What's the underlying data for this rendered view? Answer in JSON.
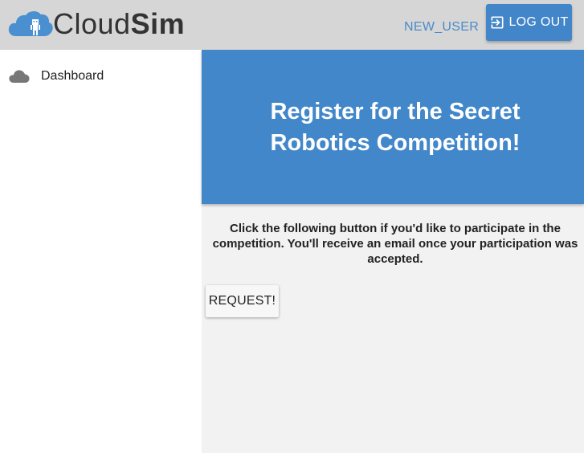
{
  "header": {
    "logo_text_regular": "Cloud",
    "logo_text_bold": "Sim",
    "username": "NEW_USER",
    "logout_label": "LOG OUT",
    "logout_icon": "exit-to-app-icon",
    "background": "#d6d6d6",
    "accent": "#4285c9"
  },
  "sidebar": {
    "items": [
      {
        "label": "Dashboard",
        "icon": "cloud-icon"
      }
    ]
  },
  "main": {
    "banner_title": "Register for the Secret Robotics Competition!",
    "banner_color": "#4287c9",
    "description": "Click the following button if you'd like to participate in the competition. You'll receive an email once your participation was accepted.",
    "request_label": "REQUEST!",
    "background": "#f2f2f2"
  }
}
